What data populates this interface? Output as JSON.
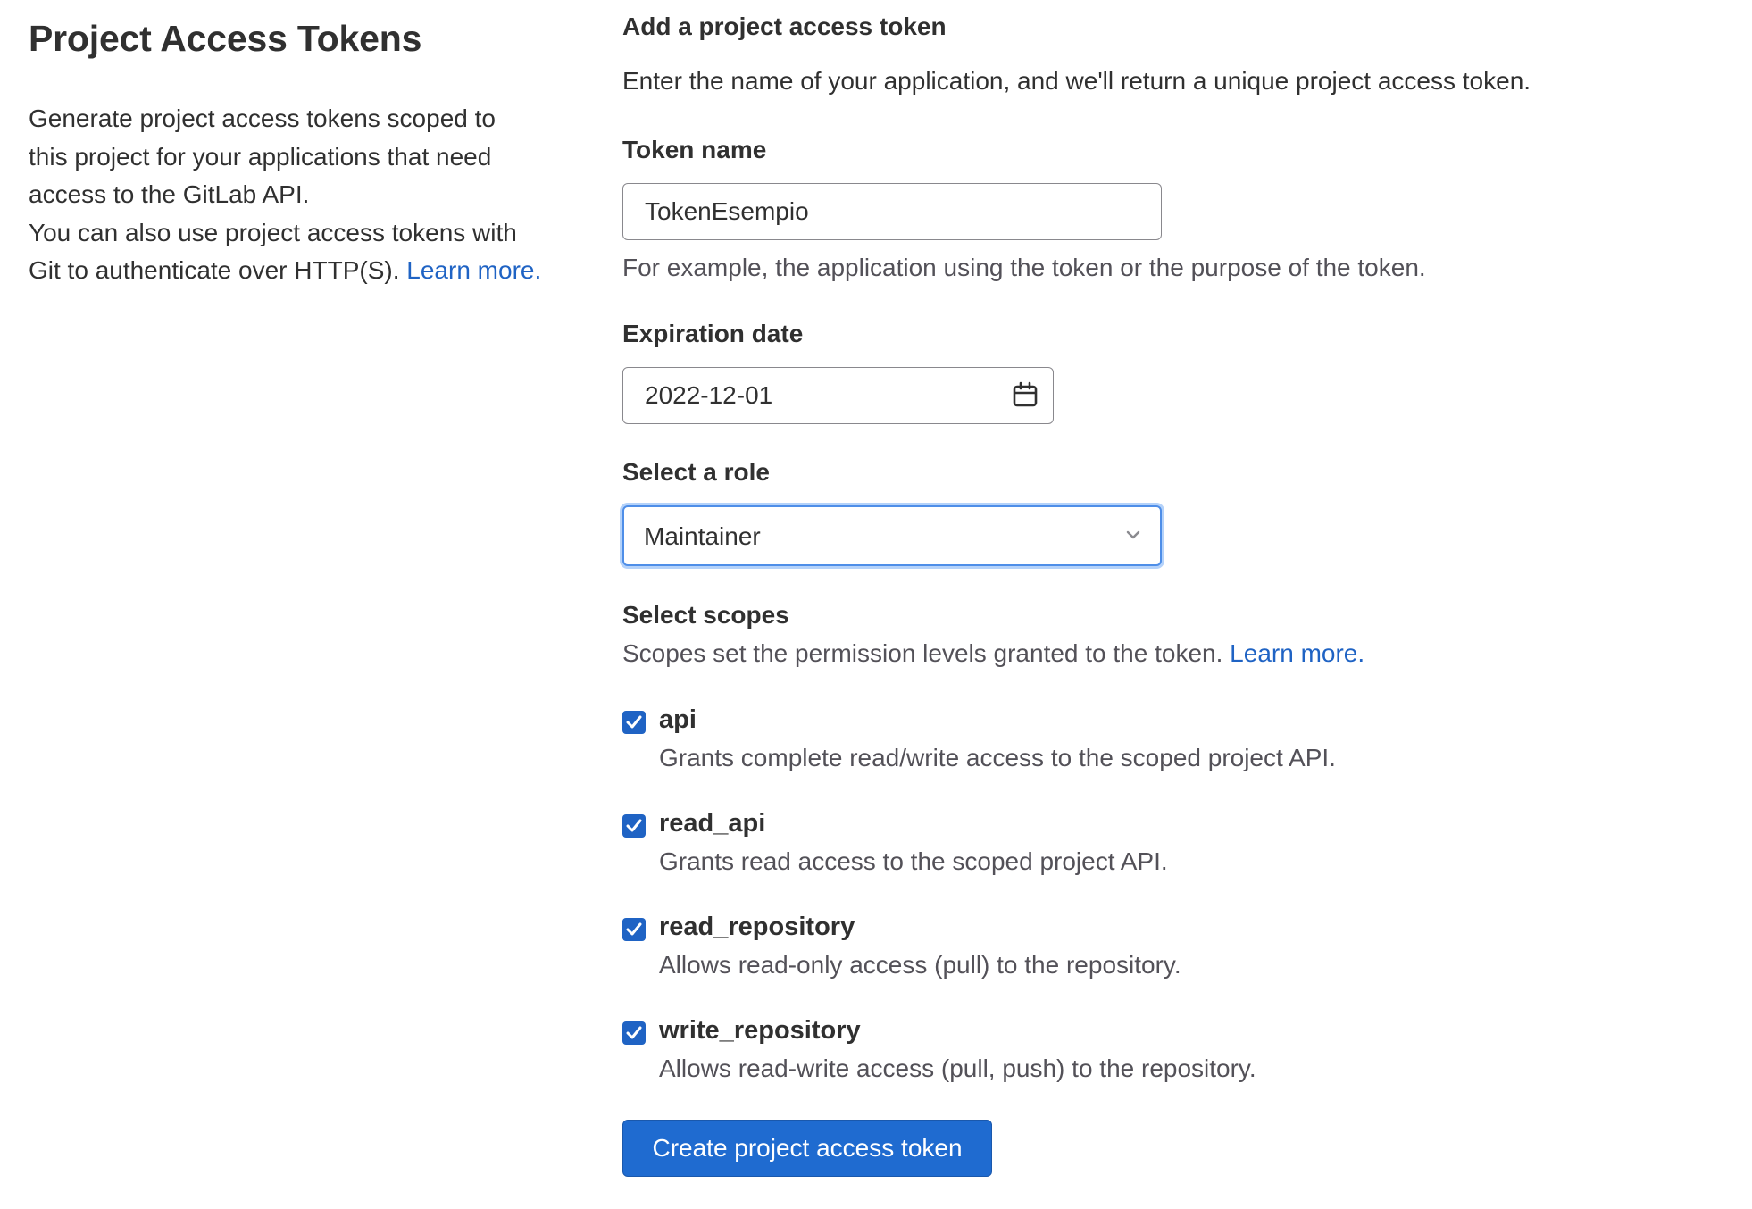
{
  "left": {
    "title": "Project Access Tokens",
    "description_line1": "Generate project access tokens scoped to",
    "description_line2": "this project for your applications that need",
    "description_line3": "access to the GitLab API.",
    "description_line4": "You can also use project access tokens with",
    "description_line5": "Git to authenticate over HTTP(S).",
    "learn_more": "Learn more."
  },
  "form": {
    "section_title": "Add a project access token",
    "section_description": "Enter the name of your application, and we'll return a unique project access token.",
    "token_name": {
      "label": "Token name",
      "value": "TokenEsempio",
      "help": "For example, the application using the token or the purpose of the token."
    },
    "expiration": {
      "label": "Expiration date",
      "value": "2022-12-01",
      "icon": "calendar-icon"
    },
    "role": {
      "label": "Select a role",
      "value": "Maintainer",
      "icon": "chevron-down-icon"
    },
    "scopes": {
      "label": "Select scopes",
      "description": "Scopes set the permission levels granted to the token.",
      "learn_more": "Learn more.",
      "items": [
        {
          "name": "api",
          "description": "Grants complete read/write access to the scoped project API.",
          "checked": true
        },
        {
          "name": "read_api",
          "description": "Grants read access to the scoped project API.",
          "checked": true
        },
        {
          "name": "read_repository",
          "description": "Allows read-only access (pull) to the repository.",
          "checked": true
        },
        {
          "name": "write_repository",
          "description": "Allows read-write access (pull, push) to the repository.",
          "checked": true
        }
      ]
    },
    "submit_label": "Create project access token"
  },
  "colors": {
    "accent": "#1f63c4",
    "button": "#1f6bd0",
    "focus_ring": "#b4d2fa",
    "text": "#303030",
    "muted_text": "#535158"
  }
}
